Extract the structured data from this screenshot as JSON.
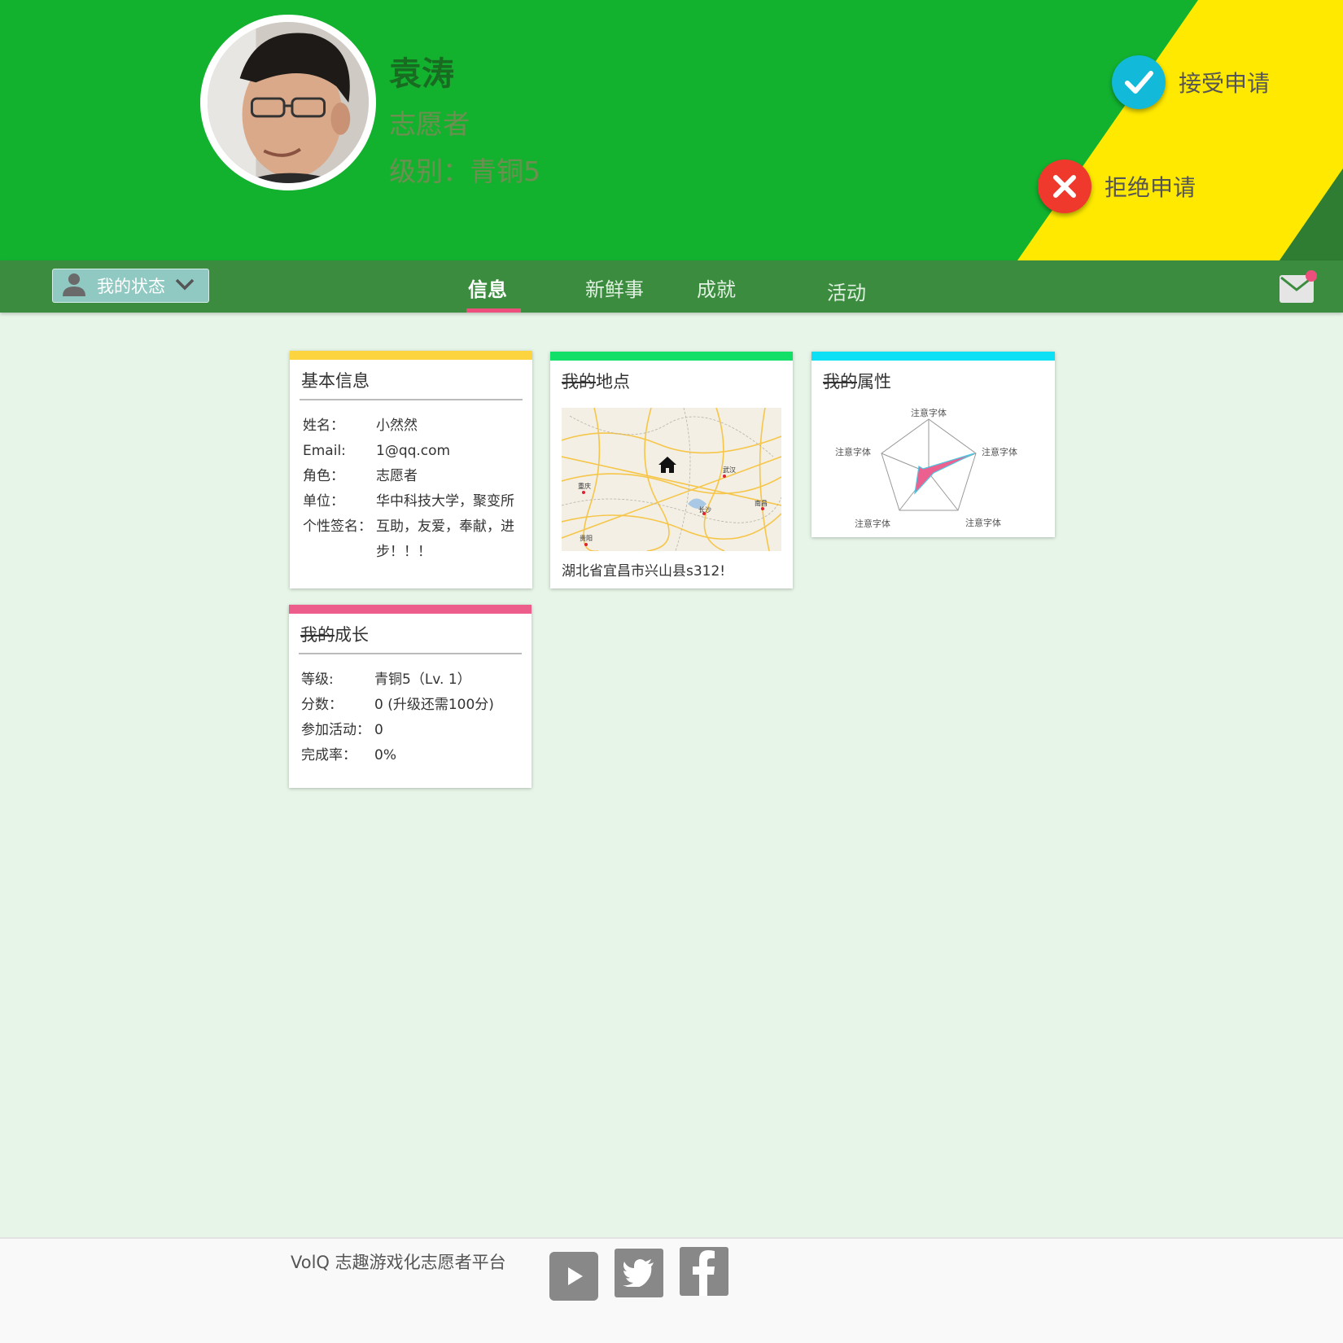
{
  "header": {
    "name": "袁涛",
    "role": "志愿者",
    "level": "级别：青铜5",
    "accept_label": "接受申请",
    "reject_label": "拒绝申请"
  },
  "nav": {
    "status_label": "我的状态",
    "tabs": [
      {
        "label": "信息",
        "active": true
      },
      {
        "label": "新鲜事",
        "active": false
      },
      {
        "label": "成就",
        "active": false
      },
      {
        "label": "活动",
        "active": false
      }
    ]
  },
  "basic_info": {
    "title": "基本信息",
    "rows": [
      {
        "key": "姓名：",
        "value": "小然然"
      },
      {
        "key": "Email:",
        "value": "1@qq.com"
      },
      {
        "key": "角色：",
        "value": "志愿者"
      },
      {
        "key": "单位：",
        "value": "华中科技大学，聚变所"
      },
      {
        "key": "个性签名：",
        "value": "互助，友爱，奉献，进步！！！"
      }
    ]
  },
  "place": {
    "title_strike": "我的",
    "title_rest": "地点",
    "address": "湖北省宜昌市兴山县s312!",
    "map_labels": [
      "重庆",
      "武汉",
      "长沙",
      "南昌",
      "贵阳"
    ]
  },
  "attributes": {
    "title_strike": "我的",
    "title_rest": "属性",
    "axis_labels": [
      "注意字体",
      "注意字体",
      "注意字体",
      "注意字体",
      "注意字体"
    ]
  },
  "growth": {
    "title_strike": "我的",
    "title_rest": "成长",
    "rows": [
      {
        "key": "等级:",
        "value": "青铜5（Lv. 1）"
      },
      {
        "key": "分数：",
        "value": "0 (升级还需100分)"
      },
      {
        "key": "参加活动：",
        "value": "0"
      },
      {
        "key": "完成率：",
        "value": "0%"
      }
    ]
  },
  "footer": {
    "text": "VolQ 志趣游戏化志愿者平台"
  },
  "colors": {
    "header_green": "#12b22f",
    "nav_green": "#3b8c3e",
    "yellow": "#ffe900",
    "accent_pink": "#ec4f7c",
    "accept_blue": "#12b9d8",
    "reject_red": "#f0392d"
  }
}
